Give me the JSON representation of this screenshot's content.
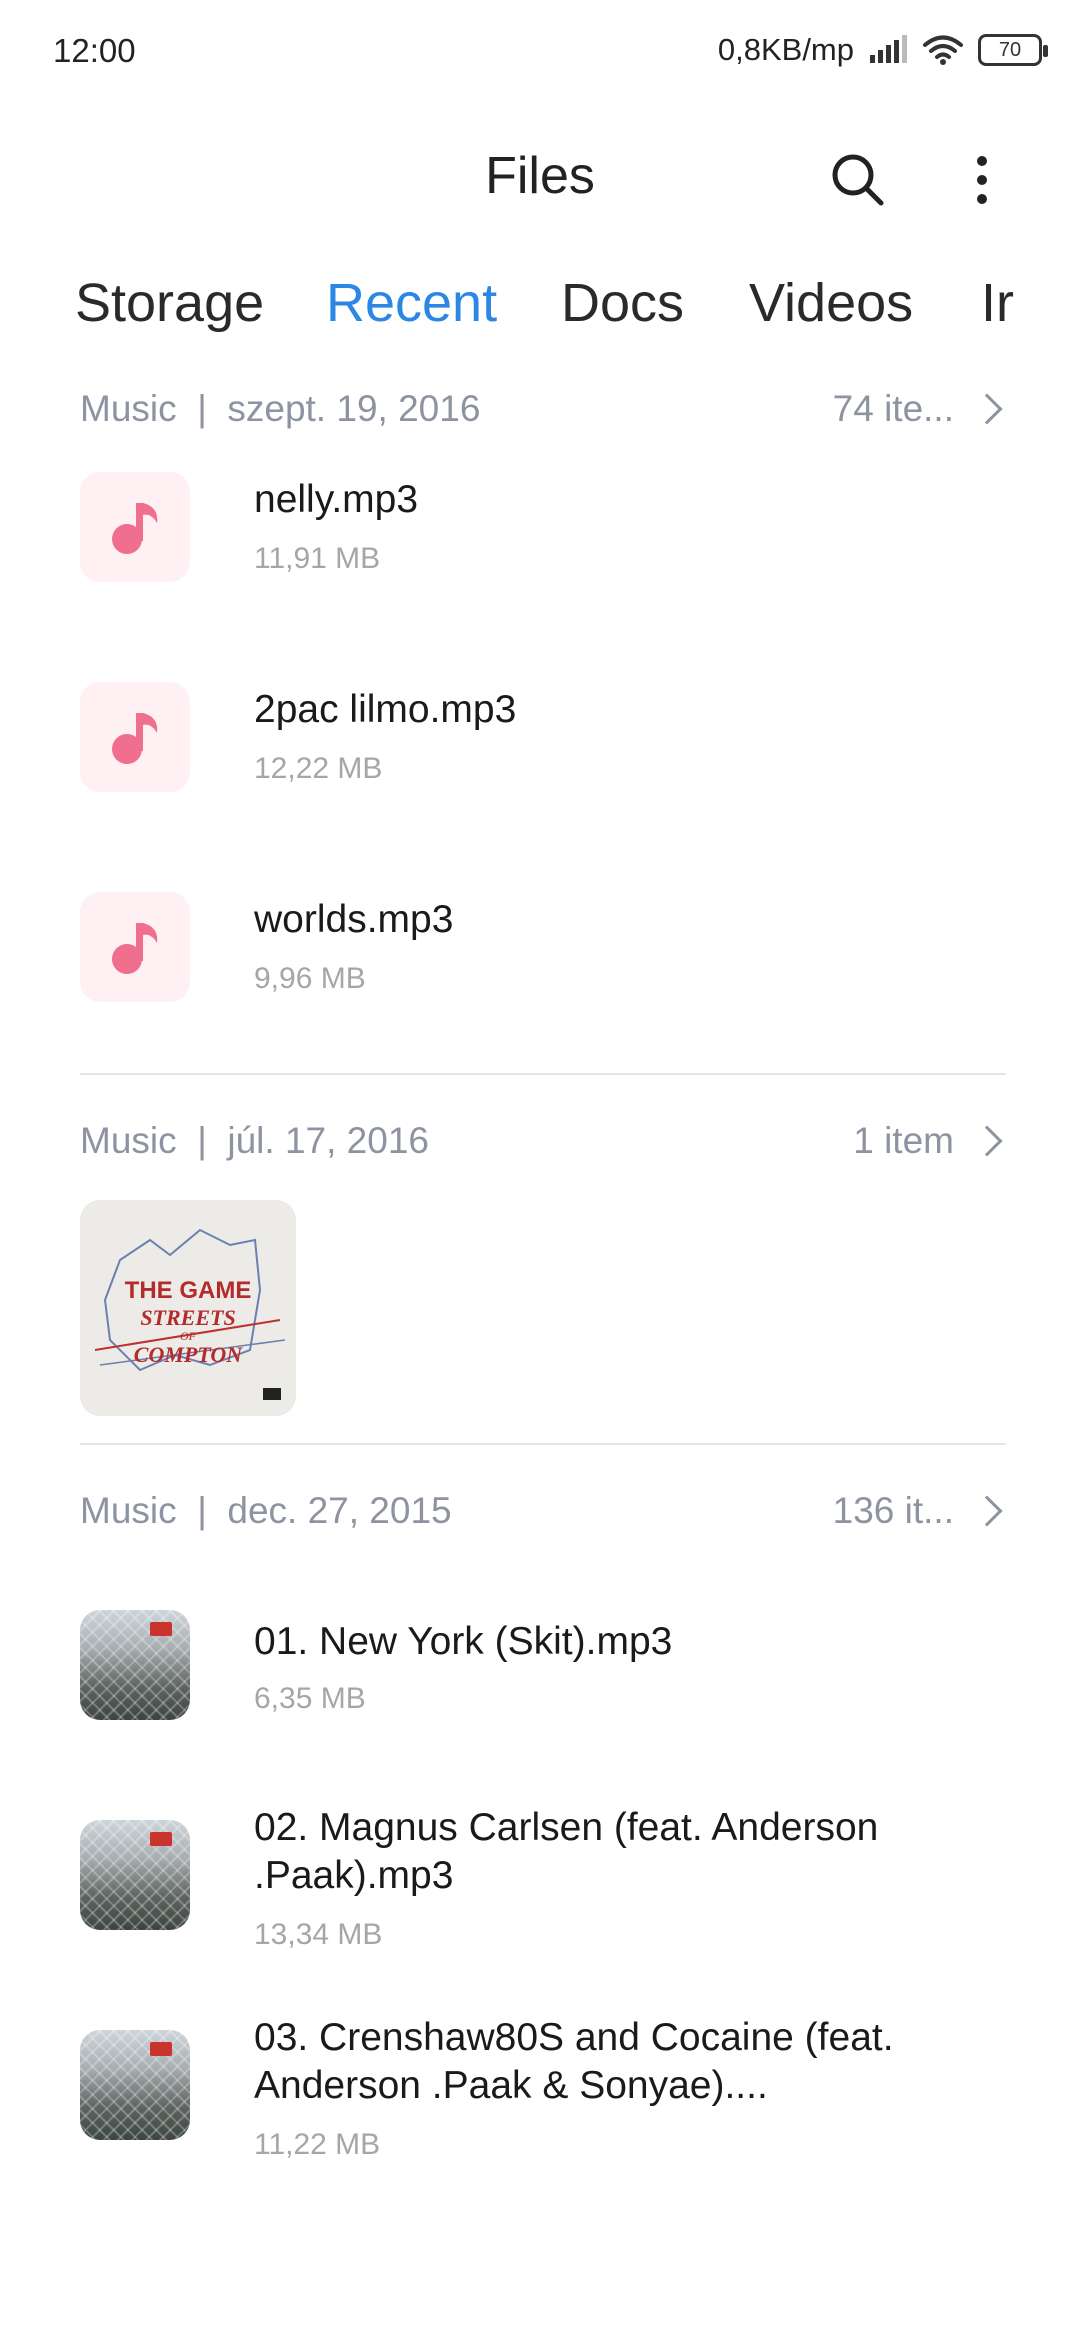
{
  "status_bar": {
    "time": "12:00",
    "network_speed": "0,8KB/mp",
    "battery": "70",
    "icons": [
      "signal-icon",
      "wifi-icon",
      "battery-icon"
    ]
  },
  "header": {
    "title": "Files",
    "icons": [
      "search-icon",
      "more-vert-icon"
    ]
  },
  "tabs": [
    {
      "label": "Storage",
      "active": false
    },
    {
      "label": "Recent",
      "active": true
    },
    {
      "label": "Docs",
      "active": false
    },
    {
      "label": "Videos",
      "active": false
    },
    {
      "label": "Ir",
      "active": false
    }
  ],
  "sections": [
    {
      "category": "Music",
      "separator": "|",
      "date": "szept. 19, 2016",
      "count": "74 ite...",
      "files": [
        {
          "name": "nelly.mp3",
          "size": "11,91 MB",
          "icon": "music-note-icon"
        },
        {
          "name": "2pac lilmo.mp3",
          "size": "12,22 MB",
          "icon": "music-note-icon"
        },
        {
          "name": "worlds.mp3",
          "size": "9,96 MB",
          "icon": "music-note-icon"
        }
      ]
    },
    {
      "category": "Music",
      "separator": "|",
      "date": "júl. 17, 2016",
      "count": "1 item",
      "album": {
        "art_text_top": "THE GAME",
        "art_text_mid": "STREETS",
        "art_text_small": "OF",
        "art_text_bottom": "COMPTON"
      }
    },
    {
      "category": "Music",
      "separator": "|",
      "date": "dec. 27, 2015",
      "count": "136 it...",
      "files": [
        {
          "name": "01. New York (Skit).mp3",
          "size": "6,35 MB",
          "icon": "album-art-thumbnail"
        },
        {
          "name": "02. Magnus Carlsen (feat. Anderson .Paak).mp3",
          "size": "13,34 MB",
          "icon": "album-art-thumbnail"
        },
        {
          "name": "03. Crenshaw80S and Cocaine (feat. Anderson .Paak & Sonyae)....",
          "size": "11,22 MB",
          "icon": "album-art-thumbnail"
        }
      ]
    }
  ],
  "colors": {
    "accent": "#2b87e3",
    "section_header": "#8d93a0",
    "music_icon": "#f06e8e",
    "music_icon_bg": "#fff0f3",
    "file_size": "#a6a6a6"
  }
}
